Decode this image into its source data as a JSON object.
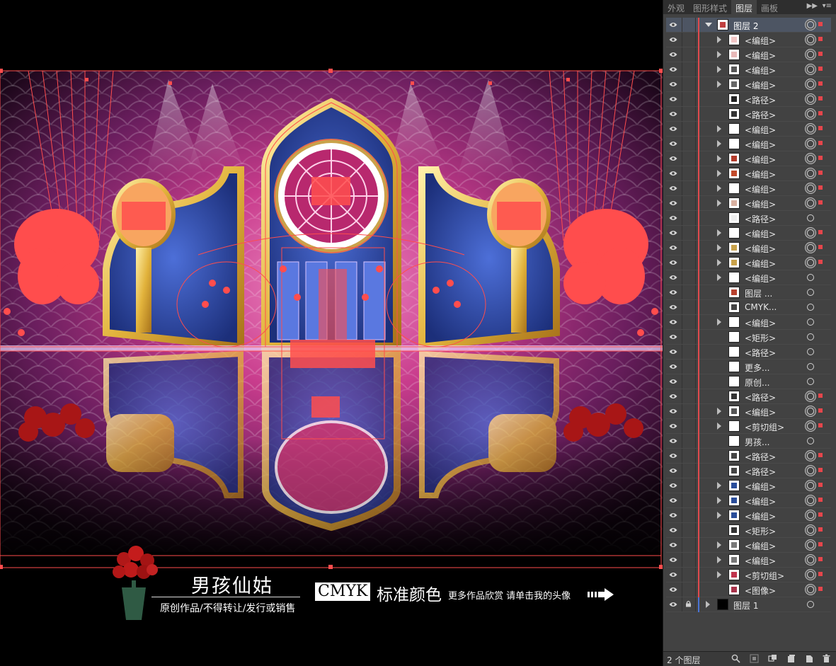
{
  "panel": {
    "tabs": [
      "外观",
      "图形样式",
      "图层",
      "画板"
    ],
    "active_tab": "图层",
    "collapse_glyph": "▶▶",
    "menu_glyph": "▾≡",
    "layers": [
      {
        "label": "图层 2",
        "kind": "layer",
        "expanded": true,
        "thumb": "#c04040"
      },
      {
        "label": "<编组>",
        "arrow": true,
        "target": "filled",
        "selected": true,
        "thumb": "#f2c6c6"
      },
      {
        "label": "<编组>",
        "arrow": true,
        "target": "filled",
        "selected": true,
        "thumb": "#e8b8b8"
      },
      {
        "label": "<编组>",
        "arrow": true,
        "target": "filled",
        "selected": true,
        "thumb": "#555"
      },
      {
        "label": "<编组>",
        "arrow": true,
        "target": "filled",
        "selected": true,
        "thumb": "#666"
      },
      {
        "label": "<路径>",
        "arrow": false,
        "target": "filled",
        "selected": true,
        "thumb": "#222"
      },
      {
        "label": "<路径>",
        "arrow": false,
        "target": "filled",
        "selected": true,
        "thumb": "#333"
      },
      {
        "label": "<编组>",
        "arrow": true,
        "target": "filled",
        "selected": true,
        "thumb": "#fff"
      },
      {
        "label": "<编组>",
        "arrow": true,
        "target": "filled",
        "selected": true,
        "thumb": "#fff"
      },
      {
        "label": "<编组>",
        "arrow": true,
        "target": "filled",
        "selected": true,
        "thumb": "#b33a2a"
      },
      {
        "label": "<编组>",
        "arrow": true,
        "target": "filled",
        "selected": true,
        "thumb": "#c24a2a"
      },
      {
        "label": "<编组>",
        "arrow": true,
        "target": "filled",
        "selected": true,
        "thumb": "#fff"
      },
      {
        "label": "<编组>",
        "arrow": true,
        "target": "filled",
        "selected": true,
        "thumb": "#d9b0a0"
      },
      {
        "label": "<路径>",
        "arrow": false,
        "target": "empty",
        "selected": false,
        "thumb": "#eee"
      },
      {
        "label": "<编组>",
        "arrow": true,
        "target": "filled",
        "selected": true,
        "thumb": "#fff"
      },
      {
        "label": "<编组>",
        "arrow": true,
        "target": "filled",
        "selected": true,
        "thumb": "#c9a24a"
      },
      {
        "label": "<编组>",
        "arrow": true,
        "target": "filled",
        "selected": true,
        "thumb": "#c9a24a"
      },
      {
        "label": "<编组>",
        "arrow": true,
        "target": "empty",
        "selected": false,
        "thumb": "#fff"
      },
      {
        "label": "图层 ...",
        "arrow": false,
        "target": "empty",
        "selected": false,
        "thumb": "#b8412e"
      },
      {
        "label": "CMYK...",
        "arrow": false,
        "target": "empty",
        "selected": false,
        "thumb": "#444"
      },
      {
        "label": "<编组>",
        "arrow": true,
        "target": "empty",
        "selected": false,
        "thumb": "#fff"
      },
      {
        "label": "<矩形>",
        "arrow": false,
        "target": "empty",
        "selected": false,
        "thumb": "#fff"
      },
      {
        "label": "<路径>",
        "arrow": false,
        "target": "empty",
        "selected": false,
        "thumb": "#fff"
      },
      {
        "label": "更多...",
        "arrow": false,
        "target": "empty",
        "selected": false,
        "thumb": "#fff"
      },
      {
        "label": "原创...",
        "arrow": false,
        "target": "empty",
        "selected": false,
        "thumb": "#fff"
      },
      {
        "label": "<路径>",
        "arrow": false,
        "target": "filled",
        "selected": true,
        "thumb": "#333"
      },
      {
        "label": "<编组>",
        "arrow": true,
        "target": "filled",
        "selected": true,
        "thumb": "#555"
      },
      {
        "label": "<剪切组>",
        "arrow": true,
        "target": "filled",
        "selected": true,
        "thumb": "#fff"
      },
      {
        "label": "男孩...",
        "arrow": false,
        "target": "empty",
        "selected": false,
        "thumb": "#fff"
      },
      {
        "label": "<路径>",
        "arrow": false,
        "target": "filled",
        "selected": true,
        "thumb": "#444"
      },
      {
        "label": "<路径>",
        "arrow": false,
        "target": "filled",
        "selected": true,
        "thumb": "#444"
      },
      {
        "label": "<编组>",
        "arrow": true,
        "target": "filled",
        "selected": true,
        "thumb": "#2a4d9a"
      },
      {
        "label": "<编组>",
        "arrow": true,
        "target": "filled",
        "selected": true,
        "thumb": "#2a4d9a"
      },
      {
        "label": "<编组>",
        "arrow": true,
        "target": "filled",
        "selected": true,
        "thumb": "#2a4d9a"
      },
      {
        "label": "<矩形>",
        "arrow": false,
        "target": "filled",
        "selected": true,
        "thumb": "#333"
      },
      {
        "label": "<编组>",
        "arrow": true,
        "target": "filled",
        "selected": true,
        "thumb": "#777"
      },
      {
        "label": "<编组>",
        "arrow": true,
        "target": "filled",
        "selected": true,
        "thumb": "#777"
      },
      {
        "label": "<剪切组>",
        "arrow": true,
        "target": "filled",
        "selected": true,
        "thumb": "#c0334d"
      },
      {
        "label": "<图像>",
        "arrow": false,
        "target": "filled",
        "selected": true,
        "thumb": "#a8324a"
      },
      {
        "label": "图层 1",
        "kind": "layer-bottom",
        "expanded": false,
        "thumb": "#000"
      }
    ],
    "status": {
      "layer_count": "2 个图层",
      "icons": [
        "search-icon",
        "locate-object-icon",
        "clipping-mask-icon",
        "new-sublayer-icon",
        "new-layer-icon",
        "trash-icon"
      ]
    }
  },
  "canvas": {
    "author_name": "男孩仙姑",
    "author_sub": "原创作品/不得转让/发行或销售",
    "cmyk_label": "CMYK",
    "cmyk_rest": "标准颜色",
    "more_works": "更多作品欣赏 请单击我的头像",
    "colors": {
      "selection": "#ff4d4d",
      "gold": "#e2b33c",
      "blue": "#243f9e",
      "pink": "#d24a8a",
      "purple": "#3a0f3a"
    }
  }
}
